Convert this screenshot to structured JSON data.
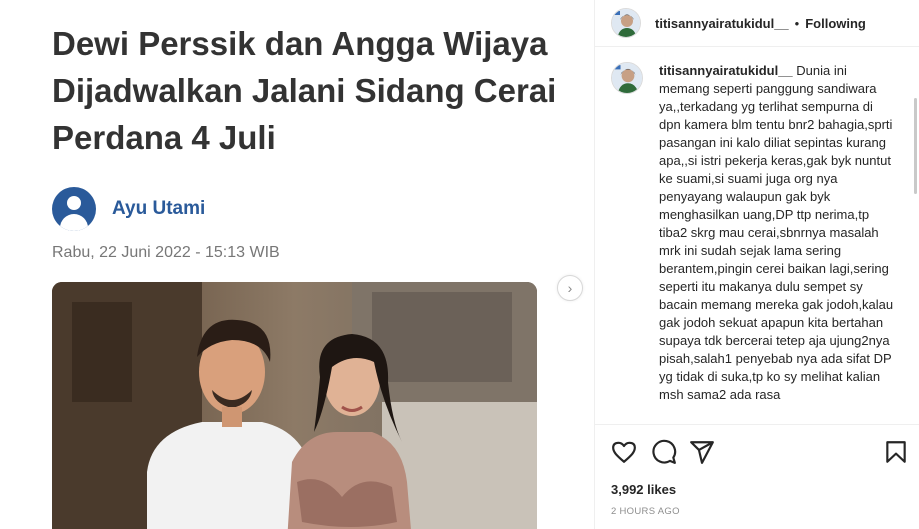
{
  "article": {
    "headline_lines": [
      "Dewi Perssik dan Angga Wijaya",
      "Dijadwalkan Jalani Sidang Cerai",
      "Perdana 4 Juli"
    ],
    "author": "Ayu Utami",
    "date": "Rabu, 22 Juni 2022 - 15:13 WIB"
  },
  "post": {
    "username": "titisannyairatukidul__",
    "separator": "•",
    "follow_status": "Following",
    "caption_user": "titisannyairatukidul__",
    "caption_text": " Dunia ini memang seperti panggung sandiwara ya,,terkadang yg terlihat sempurna di dpn kamera blm tentu bnr2 bahagia,sprti pasangan ini kalo diliat sepintas kurang apa,,si istri pekerja keras,gak byk nuntut ke suami,si suami juga org nya penyayang walaupun gak byk menghasilkan uang,DP ttp nerima,tp tiba2 skrg mau cerai,sbnrnya masalah mrk ini sudah sejak lama sering berantem,pingin cerei baikan lagi,sering seperti itu makanya dulu sempet sy bacain memang mereka gak jodoh,kalau gak jodoh sekuat apapun kita bertahan supaya tdk bercerai tetep aja ujung2nya pisah,salah1 penyebab nya ada sifat DP yg tidak di suka,tp ko sy melihat kalian msh sama2 ada rasa",
    "likes": "3,992 likes",
    "time_ago": "2 HOURS AGO"
  },
  "icons": {
    "like": "heart-icon",
    "comment": "comment-icon",
    "share": "paper-plane-icon",
    "save": "bookmark-icon",
    "next": "chevron-right-icon"
  },
  "colors": {
    "author_blue": "#2a5a9a",
    "headline": "#333333",
    "muted": "#8e8e8e"
  }
}
